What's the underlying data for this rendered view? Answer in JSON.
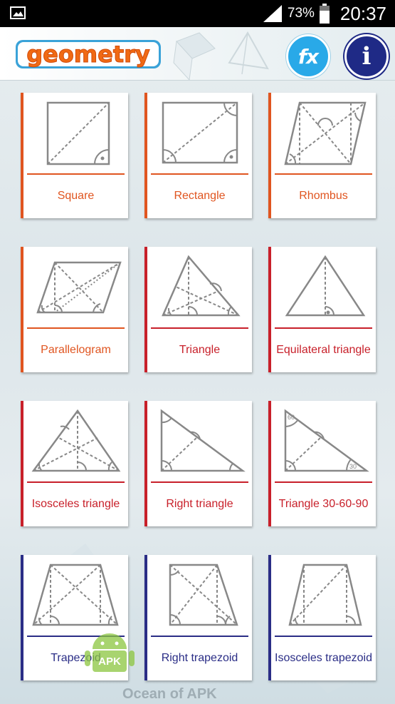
{
  "status": {
    "battery": "73%",
    "time": "20:37"
  },
  "header": {
    "logo_text": "geometry",
    "fx_label": "fx",
    "info_label": "i"
  },
  "shapes": [
    {
      "label": "Square"
    },
    {
      "label": "Rectangle"
    },
    {
      "label": "Rhombus"
    },
    {
      "label": "Parallelogram"
    },
    {
      "label": "Triangle"
    },
    {
      "label": "Equilateral triangle"
    },
    {
      "label": "Isosceles triangle"
    },
    {
      "label": "Right triangle"
    },
    {
      "label": "Triangle 30-60-90",
      "angle_marks": [
        "60",
        "30"
      ]
    },
    {
      "label": "Trapezoid"
    },
    {
      "label": "Right trapezoid"
    },
    {
      "label": "Isosceles trapezoid"
    }
  ],
  "watermark": {
    "text": "Ocean of APK",
    "badge": "APK"
  },
  "colors": {
    "orange": "#e05520",
    "red": "#c8202a",
    "navy": "#2a2d86",
    "fx_blue": "#29a9e8",
    "info_navy": "#1f2a86"
  }
}
